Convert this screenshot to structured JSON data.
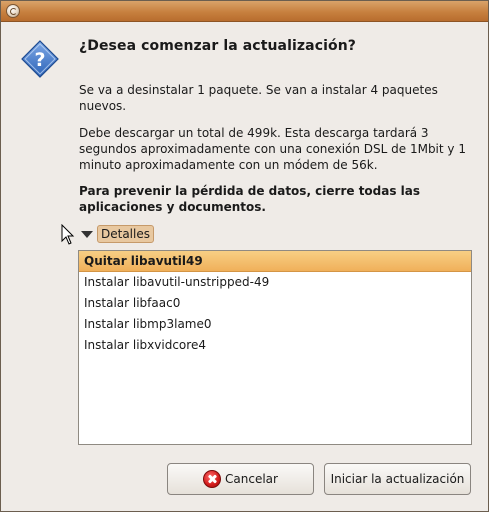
{
  "dialog": {
    "heading": "¿Desea comenzar la actualización?",
    "summary": "Se va a desinstalar 1 paquete. Se van a instalar 4 paquetes nuevos.",
    "download_info": "Debe descargar un total de 499k. Esta descarga tardará 3 segundos aproximadamente con una conexión DSL de 1Mbit y 1 minuto aproximadamente con un módem de 56k.",
    "warning": "Para prevenir la pérdida de datos, cierre todas las aplicaciones y documentos.",
    "icon": "question-icon"
  },
  "details": {
    "label": "Detalles",
    "expanded": true,
    "items": [
      {
        "label": "Quitar libavutil49",
        "selected": true
      },
      {
        "label": "Instalar libavutil-unstripped-49",
        "selected": false
      },
      {
        "label": "Instalar libfaac0",
        "selected": false
      },
      {
        "label": "Instalar libmp3lame0",
        "selected": false
      },
      {
        "label": "Instalar libxvidcore4",
        "selected": false
      }
    ]
  },
  "buttons": {
    "cancel_label": "Cancelar",
    "start_label": "Iniciar la actualización"
  },
  "colors": {
    "titlebar": "#c7803f",
    "selection": "#f0b05a",
    "window_bg": "#efebe7",
    "icon_blue": "#2c63b8"
  }
}
